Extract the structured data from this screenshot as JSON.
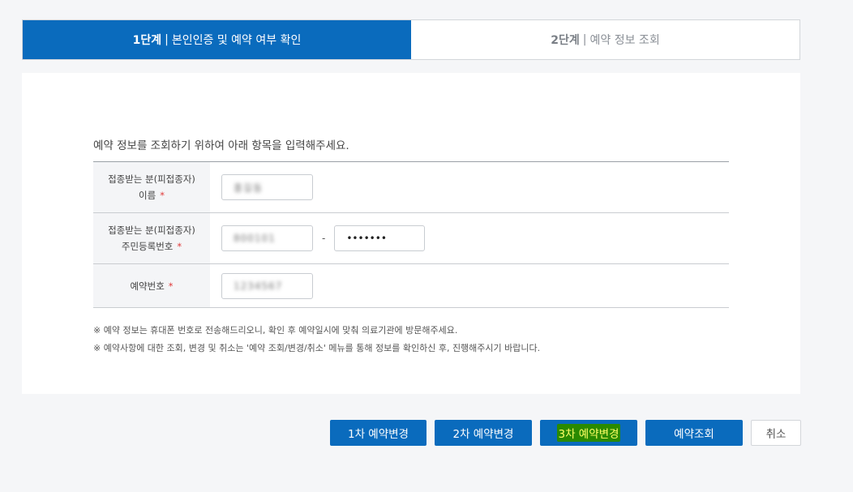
{
  "steps": [
    {
      "num": "1단계",
      "sep": "|",
      "label": "본인인증 및 예약 여부 확인",
      "active": true
    },
    {
      "num": "2단계",
      "sep": "|",
      "label": "예약 정보 조회",
      "active": false
    }
  ],
  "intro": "예약 정보를 조회하기 위하여 아래 항목을 입력해주세요.",
  "form": {
    "name_label_1": "접종받는 분(피접종자)",
    "name_label_2": "이름",
    "name_value": "홍길동",
    "rrn_label_1": "접종받는 분(피접종자)",
    "rrn_label_2": "주민등록번호",
    "rrn_front": "800101",
    "rrn_dash": "-",
    "rrn_back": "•••••••",
    "booking_label": "예약번호",
    "booking_value": "1234567",
    "required_mark": "*"
  },
  "notes": [
    "※ 예약 정보는 휴대폰 번호로 전송해드리오니, 확인 후 예약일시에 맞춰 의료기관에 방문해주세요.",
    "※ 예약사항에 대한 조회, 변경 및 취소는 '예약 조회/변경/취소' 메뉴를 통해 정보를 확인하신 후, 진행해주시기 바랍니다."
  ],
  "buttons": {
    "change1": "1차 예약변경",
    "change2": "2차 예약변경",
    "change3": "3차 예약변경",
    "lookup": "예약조회",
    "cancel": "취소"
  },
  "colors": {
    "primary": "#0a6bbd",
    "required": "#e03a3a",
    "highlight_bg": "#2a8a00",
    "highlight_text": "#ffff66"
  }
}
